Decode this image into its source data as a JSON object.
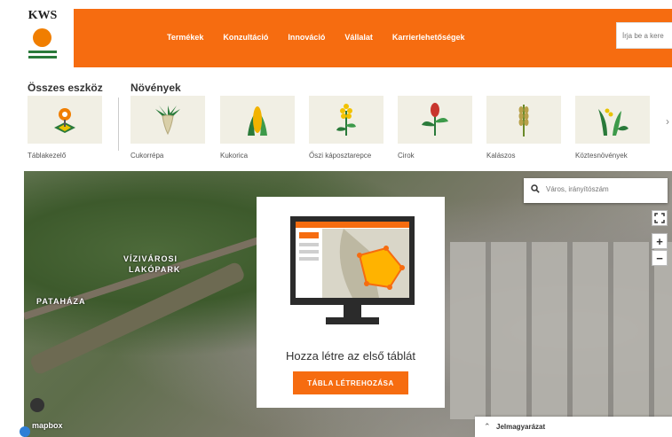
{
  "brand": {
    "logo_text": "KWS",
    "accent": "#f66c10",
    "green": "#2a7a3a"
  },
  "nav": {
    "items": [
      "Termékek",
      "Konzultáció",
      "Innováció",
      "Vállalat",
      "Karrierlehetőségek"
    ],
    "search_placeholder": "Írja be a kere"
  },
  "sections": {
    "tools_title": "Összes eszköz",
    "plants_title": "Növények"
  },
  "tools": [
    {
      "label": "Táblakezelő",
      "icon": "field-manager-icon"
    },
    {
      "label": "Cukorrépa",
      "icon": "sugar-beet-icon"
    },
    {
      "label": "Kukorica",
      "icon": "corn-icon"
    },
    {
      "label": "Őszi káposztarepce",
      "icon": "rapeseed-icon"
    },
    {
      "label": "Cirok",
      "icon": "sorghum-icon"
    },
    {
      "label": "Kalászos",
      "icon": "cereal-icon"
    },
    {
      "label": "Köztesnövények",
      "icon": "cover-crop-icon"
    }
  ],
  "map": {
    "search_placeholder": "Város, irányítószám",
    "labels": [
      "VÍZIVÁROSI",
      "LAKÓPARK",
      "PATAHÁZA"
    ],
    "zoom_in": "+",
    "zoom_out": "−",
    "attribution": "mapbox",
    "legend_label": "Jelmagyarázat"
  },
  "modal": {
    "title": "Hozza létre az első táblát",
    "button": "TÁBLA LÉTREHOZÁSA"
  }
}
